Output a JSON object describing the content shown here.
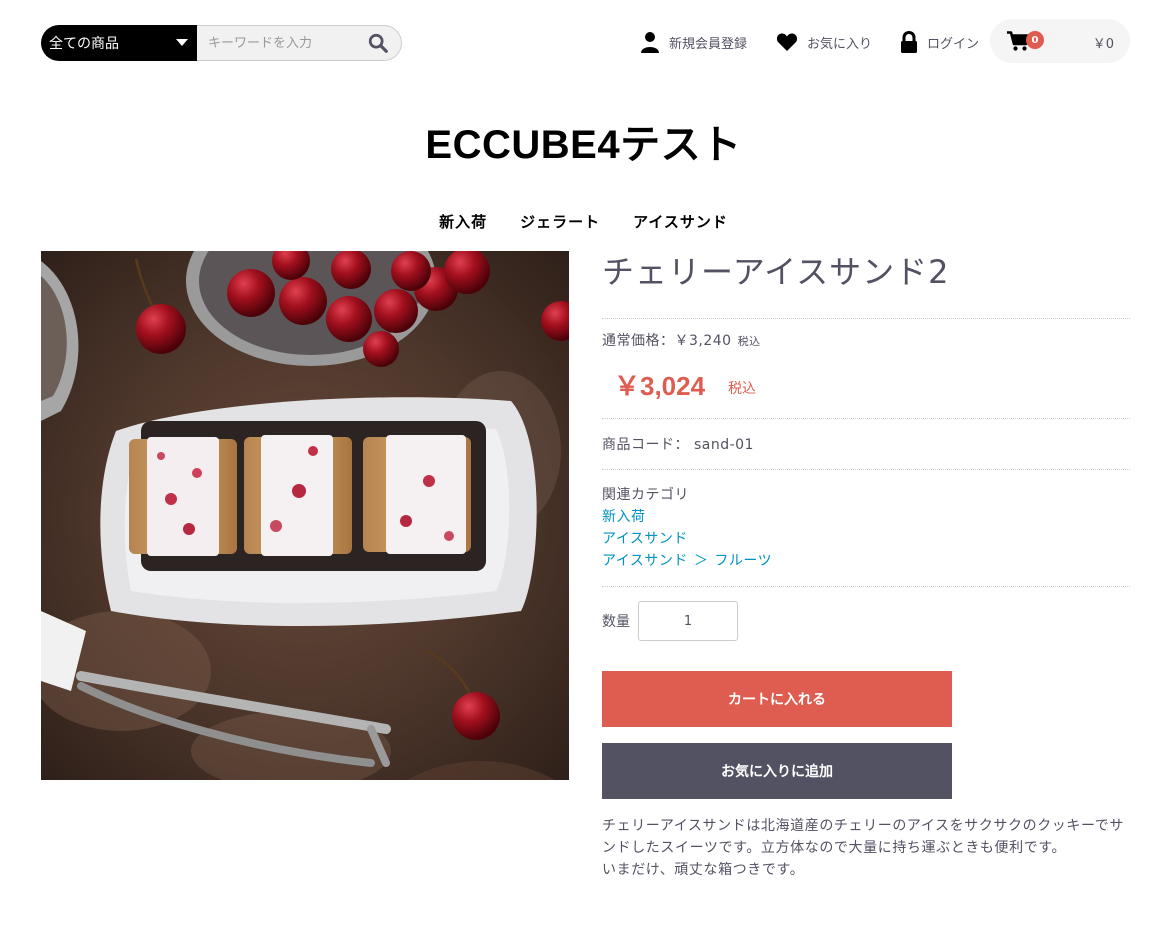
{
  "header": {
    "category_select": "全ての商品",
    "search_placeholder": "キーワードを入力",
    "register_label": "新規会員登録",
    "favorites_label": "お気に入り",
    "login_label": "ログイン",
    "cart_count": "0",
    "cart_total": "￥0"
  },
  "site": {
    "title": "ECCUBE4テスト"
  },
  "category_nav": [
    "新入荷",
    "ジェラート",
    "アイスサンド"
  ],
  "product": {
    "name": "チェリーアイスサンド2",
    "regular_price_label": "通常価格：￥3,240",
    "regular_price_tax": "税込",
    "sale_price": "￥3,024",
    "sale_price_tax": "税込",
    "code": "商品コード： sand-01",
    "related_label": "関連カテゴリ",
    "related_categories": [
      "新入荷",
      "アイスサンド"
    ],
    "related_path_parent": "アイスサンド",
    "related_path_sep": "＞",
    "related_path_child": "フルーツ",
    "quantity_label": "数量",
    "quantity_value": "1",
    "add_to_cart_label": "カートに入れる",
    "add_to_favorites_label": "お気に入りに追加",
    "description_line1": "チェリーアイスサンドは北海道産のチェリーのアイスをサクサクのクッキーでサンドしたスイーツです。立方体なので大量に持ち運ぶときも便利です。",
    "description_line2": "いまだけ、頑丈な箱つきです。"
  },
  "colors": {
    "accent": "#de5d50",
    "dark_button": "#525263",
    "link": "#0092c4"
  },
  "icons": [
    "search-icon",
    "user-icon",
    "heart-icon",
    "lock-icon",
    "cart-icon"
  ]
}
